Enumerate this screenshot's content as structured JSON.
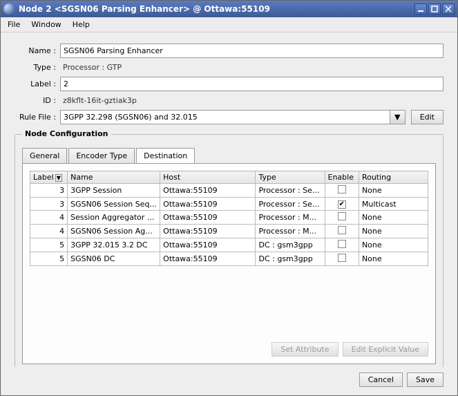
{
  "window": {
    "title": "Node 2 <SGSN06 Parsing Enhancer> @ Ottawa:55109"
  },
  "menu": {
    "file": "File",
    "window": "Window",
    "help": "Help"
  },
  "form": {
    "name_label": "Name :",
    "name_value": "SGSN06 Parsing Enhancer",
    "type_label": "Type :",
    "type_value": "Processor : GTP",
    "label_label": "Label :",
    "label_value": "2",
    "id_label": "ID :",
    "id_value": "z8kflt-16it-gztiak3p",
    "rule_label": "Rule File :",
    "rule_value": "3GPP 32.298 (SGSN06) and 32.015",
    "edit_btn": "Edit"
  },
  "fieldset": {
    "legend": "Node Configuration",
    "tabs": {
      "general": "General",
      "encoder": "Encoder Type",
      "dest": "Destination"
    },
    "columns": {
      "label": "Label",
      "name": "Name",
      "host": "Host",
      "type": "Type",
      "enable": "Enable",
      "routing": "Routing"
    },
    "rows": [
      {
        "label": "3",
        "name": "3GPP Session",
        "host": "Ottawa:55109",
        "type": "Processor : Se...",
        "enable": false,
        "routing": "None"
      },
      {
        "label": "3",
        "name": "SGSN06 Session Seq...",
        "host": "Ottawa:55109",
        "type": "Processor : Se...",
        "enable": true,
        "routing": "Multicast"
      },
      {
        "label": "4",
        "name": "Session Aggregator ...",
        "host": "Ottawa:55109",
        "type": "Processor : M...",
        "enable": false,
        "routing": "None"
      },
      {
        "label": "4",
        "name": "SGSN06 Session Ag...",
        "host": "Ottawa:55109",
        "type": "Processor : M...",
        "enable": false,
        "routing": "None"
      },
      {
        "label": "5",
        "name": "3GPP 32.015 3.2 DC",
        "host": "Ottawa:55109",
        "type": "DC : gsm3gpp",
        "enable": false,
        "routing": "None"
      },
      {
        "label": "5",
        "name": "SGSN06 DC",
        "host": "Ottawa:55109",
        "type": "DC : gsm3gpp",
        "enable": false,
        "routing": "None"
      }
    ],
    "set_attr_btn": "Set Attribute",
    "edit_explicit_btn": "Edit Explicit Value"
  },
  "footer": {
    "cancel": "Cancel",
    "save": "Save"
  }
}
